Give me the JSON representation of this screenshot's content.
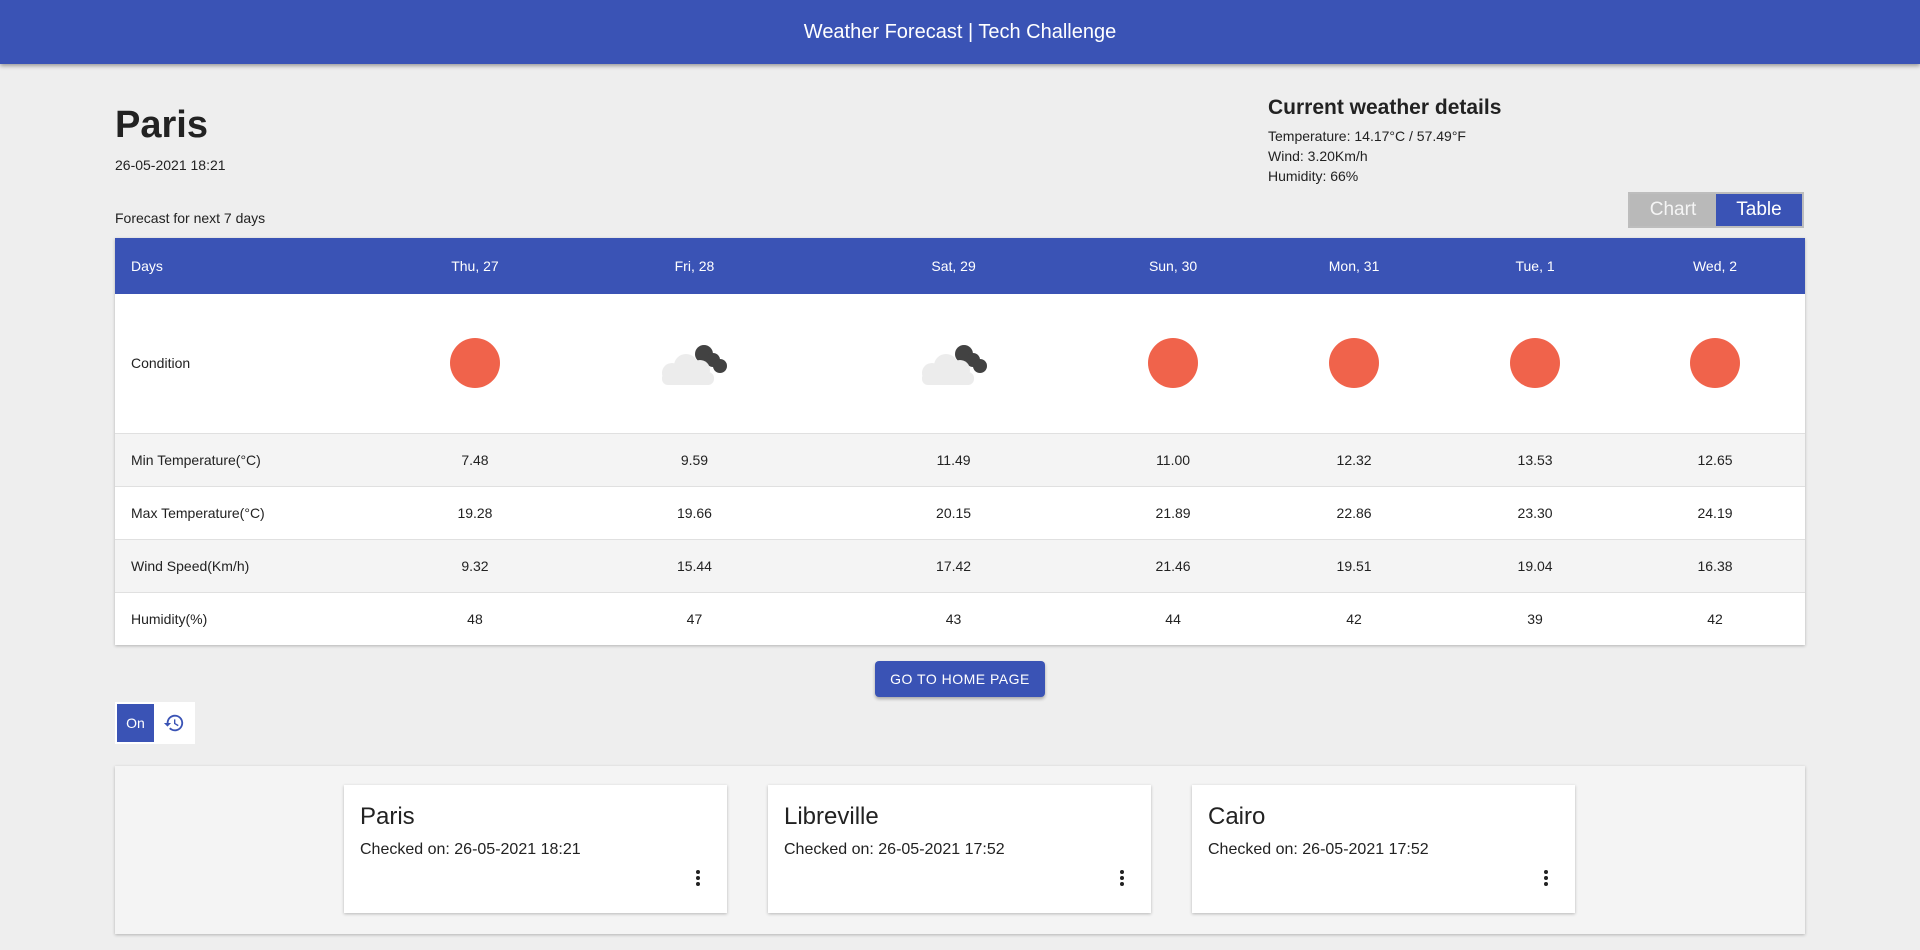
{
  "app": {
    "title": "Weather Forecast | Tech Challenge"
  },
  "location": {
    "city": "Paris",
    "datetime": "26-05-2021 18:21"
  },
  "current": {
    "title": "Current weather details",
    "temperature": "Temperature: 14.17°C / 57.49°F",
    "wind": "Wind: 3.20Km/h",
    "humidity": "Humidity: 66%"
  },
  "view_toggle": {
    "chart": "Chart",
    "table": "Table",
    "selected": "Table"
  },
  "forecast": {
    "label": "Forecast for next 7 days",
    "header": "Days",
    "days": [
      "Thu, 27",
      "Fri, 28",
      "Sat, 29",
      "Sun, 30",
      "Mon, 31",
      "Tue, 1",
      "Wed, 2"
    ],
    "conditions": [
      "sun-icon",
      "cloud-moon-icon",
      "cloud-moon-icon",
      "sun-icon",
      "sun-icon",
      "sun-icon",
      "sun-icon"
    ],
    "rows": [
      {
        "label": "Min Temperature(°C)",
        "values": [
          "7.48",
          "9.59",
          "11.49",
          "11.00",
          "12.32",
          "13.53",
          "12.65"
        ]
      },
      {
        "label": "Max Temperature(°C)",
        "values": [
          "19.28",
          "19.66",
          "20.15",
          "21.89",
          "22.86",
          "23.30",
          "24.19"
        ]
      },
      {
        "label": "Wind Speed(Km/h)",
        "values": [
          "9.32",
          "15.44",
          "17.42",
          "21.46",
          "19.51",
          "19.04",
          "16.38"
        ]
      },
      {
        "label": "Humidity(%)",
        "values": [
          "48",
          "47",
          "43",
          "44",
          "42",
          "39",
          "42"
        ]
      }
    ],
    "condition_label": "Condition"
  },
  "home_button": "GO TO HOME PAGE",
  "history_switch": {
    "on_label": "On"
  },
  "history": [
    {
      "city": "Paris",
      "checked": "Checked on: 26-05-2021 18:21"
    },
    {
      "city": "Libreville",
      "checked": "Checked on: 26-05-2021 17:52"
    },
    {
      "city": "Cairo",
      "checked": "Checked on: 26-05-2021 17:52"
    }
  ],
  "colors": {
    "primary": "#3a53b5",
    "sun": "#f0634b",
    "background": "#eeeeee"
  }
}
